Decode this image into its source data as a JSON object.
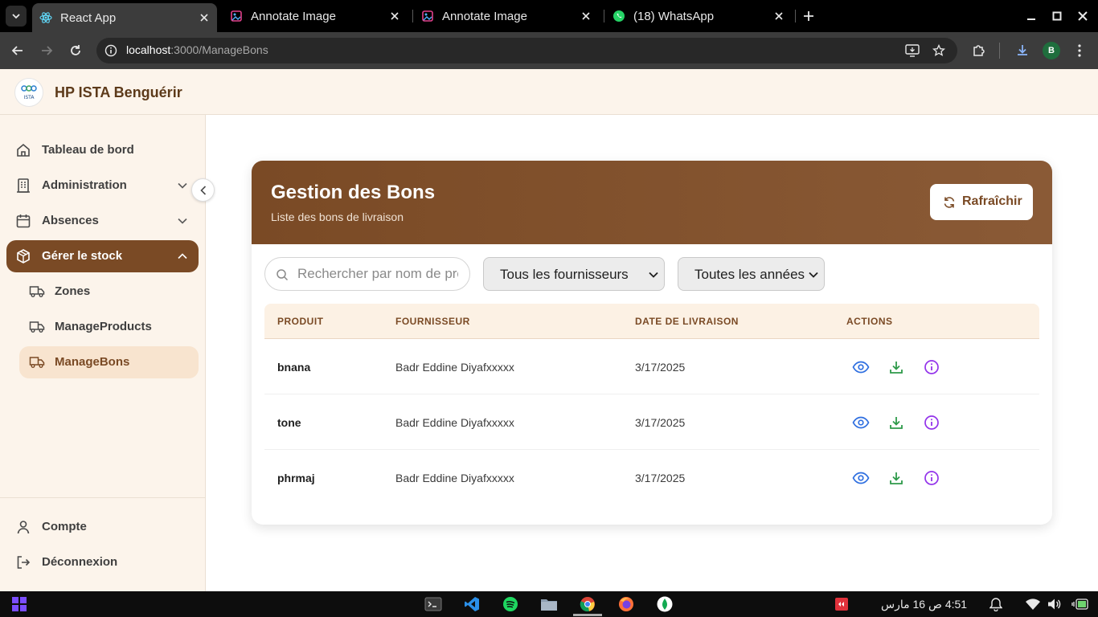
{
  "browser": {
    "tabs": [
      {
        "title": "React App",
        "active": true
      },
      {
        "title": "Annotate Image",
        "active": false
      },
      {
        "title": "Annotate Image",
        "active": false
      },
      {
        "title": "(18) WhatsApp",
        "active": false
      }
    ],
    "url_host": "localhost",
    "url_path": ":3000/ManageBons",
    "profile_initial": "B"
  },
  "header": {
    "brand": "HP ISTA Benguérir",
    "logo_text": "ISTA"
  },
  "sidebar": {
    "items": [
      {
        "label": "Tableau de bord",
        "icon": "home-icon"
      },
      {
        "label": "Administration",
        "icon": "building-icon"
      },
      {
        "label": "Absences",
        "icon": "calendar-icon"
      },
      {
        "label": "Gérer le stock",
        "icon": "package-icon"
      }
    ],
    "sub_items": [
      {
        "label": "Zones",
        "icon": "truck-icon"
      },
      {
        "label": "ManageProducts",
        "icon": "truck-icon"
      },
      {
        "label": "ManageBons",
        "icon": "truck-icon"
      }
    ],
    "footer": [
      {
        "label": "Compte",
        "icon": "user-icon"
      },
      {
        "label": "Déconnexion",
        "icon": "logout-icon"
      }
    ]
  },
  "card": {
    "title": "Gestion des Bons",
    "subtitle": "Liste des bons de livraison",
    "refresh_label": "Rafraîchir"
  },
  "filters": {
    "search_placeholder": "Rechercher par nom de produit",
    "supplier_select": "Tous les fournisseurs",
    "year_select": "Toutes les années"
  },
  "table": {
    "headers": [
      "PRODUIT",
      "FOURNISSEUR",
      "DATE DE LIVRAISON",
      "ACTIONS"
    ],
    "rows": [
      {
        "produit": "bnana",
        "fournisseur": "Badr Eddine Diyafxxxxx",
        "date": "3/17/2025"
      },
      {
        "produit": "tone",
        "fournisseur": "Badr Eddine Diyafxxxxx",
        "date": "3/17/2025"
      },
      {
        "produit": "phrmaj",
        "fournisseur": "Badr Eddine Diyafxxxxx",
        "date": "3/17/2025"
      }
    ]
  },
  "taskbar": {
    "clock": "4:51 ص  16 مارس"
  },
  "colors": {
    "brand_brown": "#7a4a25",
    "sidebar_bg": "#fcf4eb",
    "view_blue": "#2f6fe0",
    "download_green": "#2e9a4a",
    "info_purple": "#9333ea"
  }
}
